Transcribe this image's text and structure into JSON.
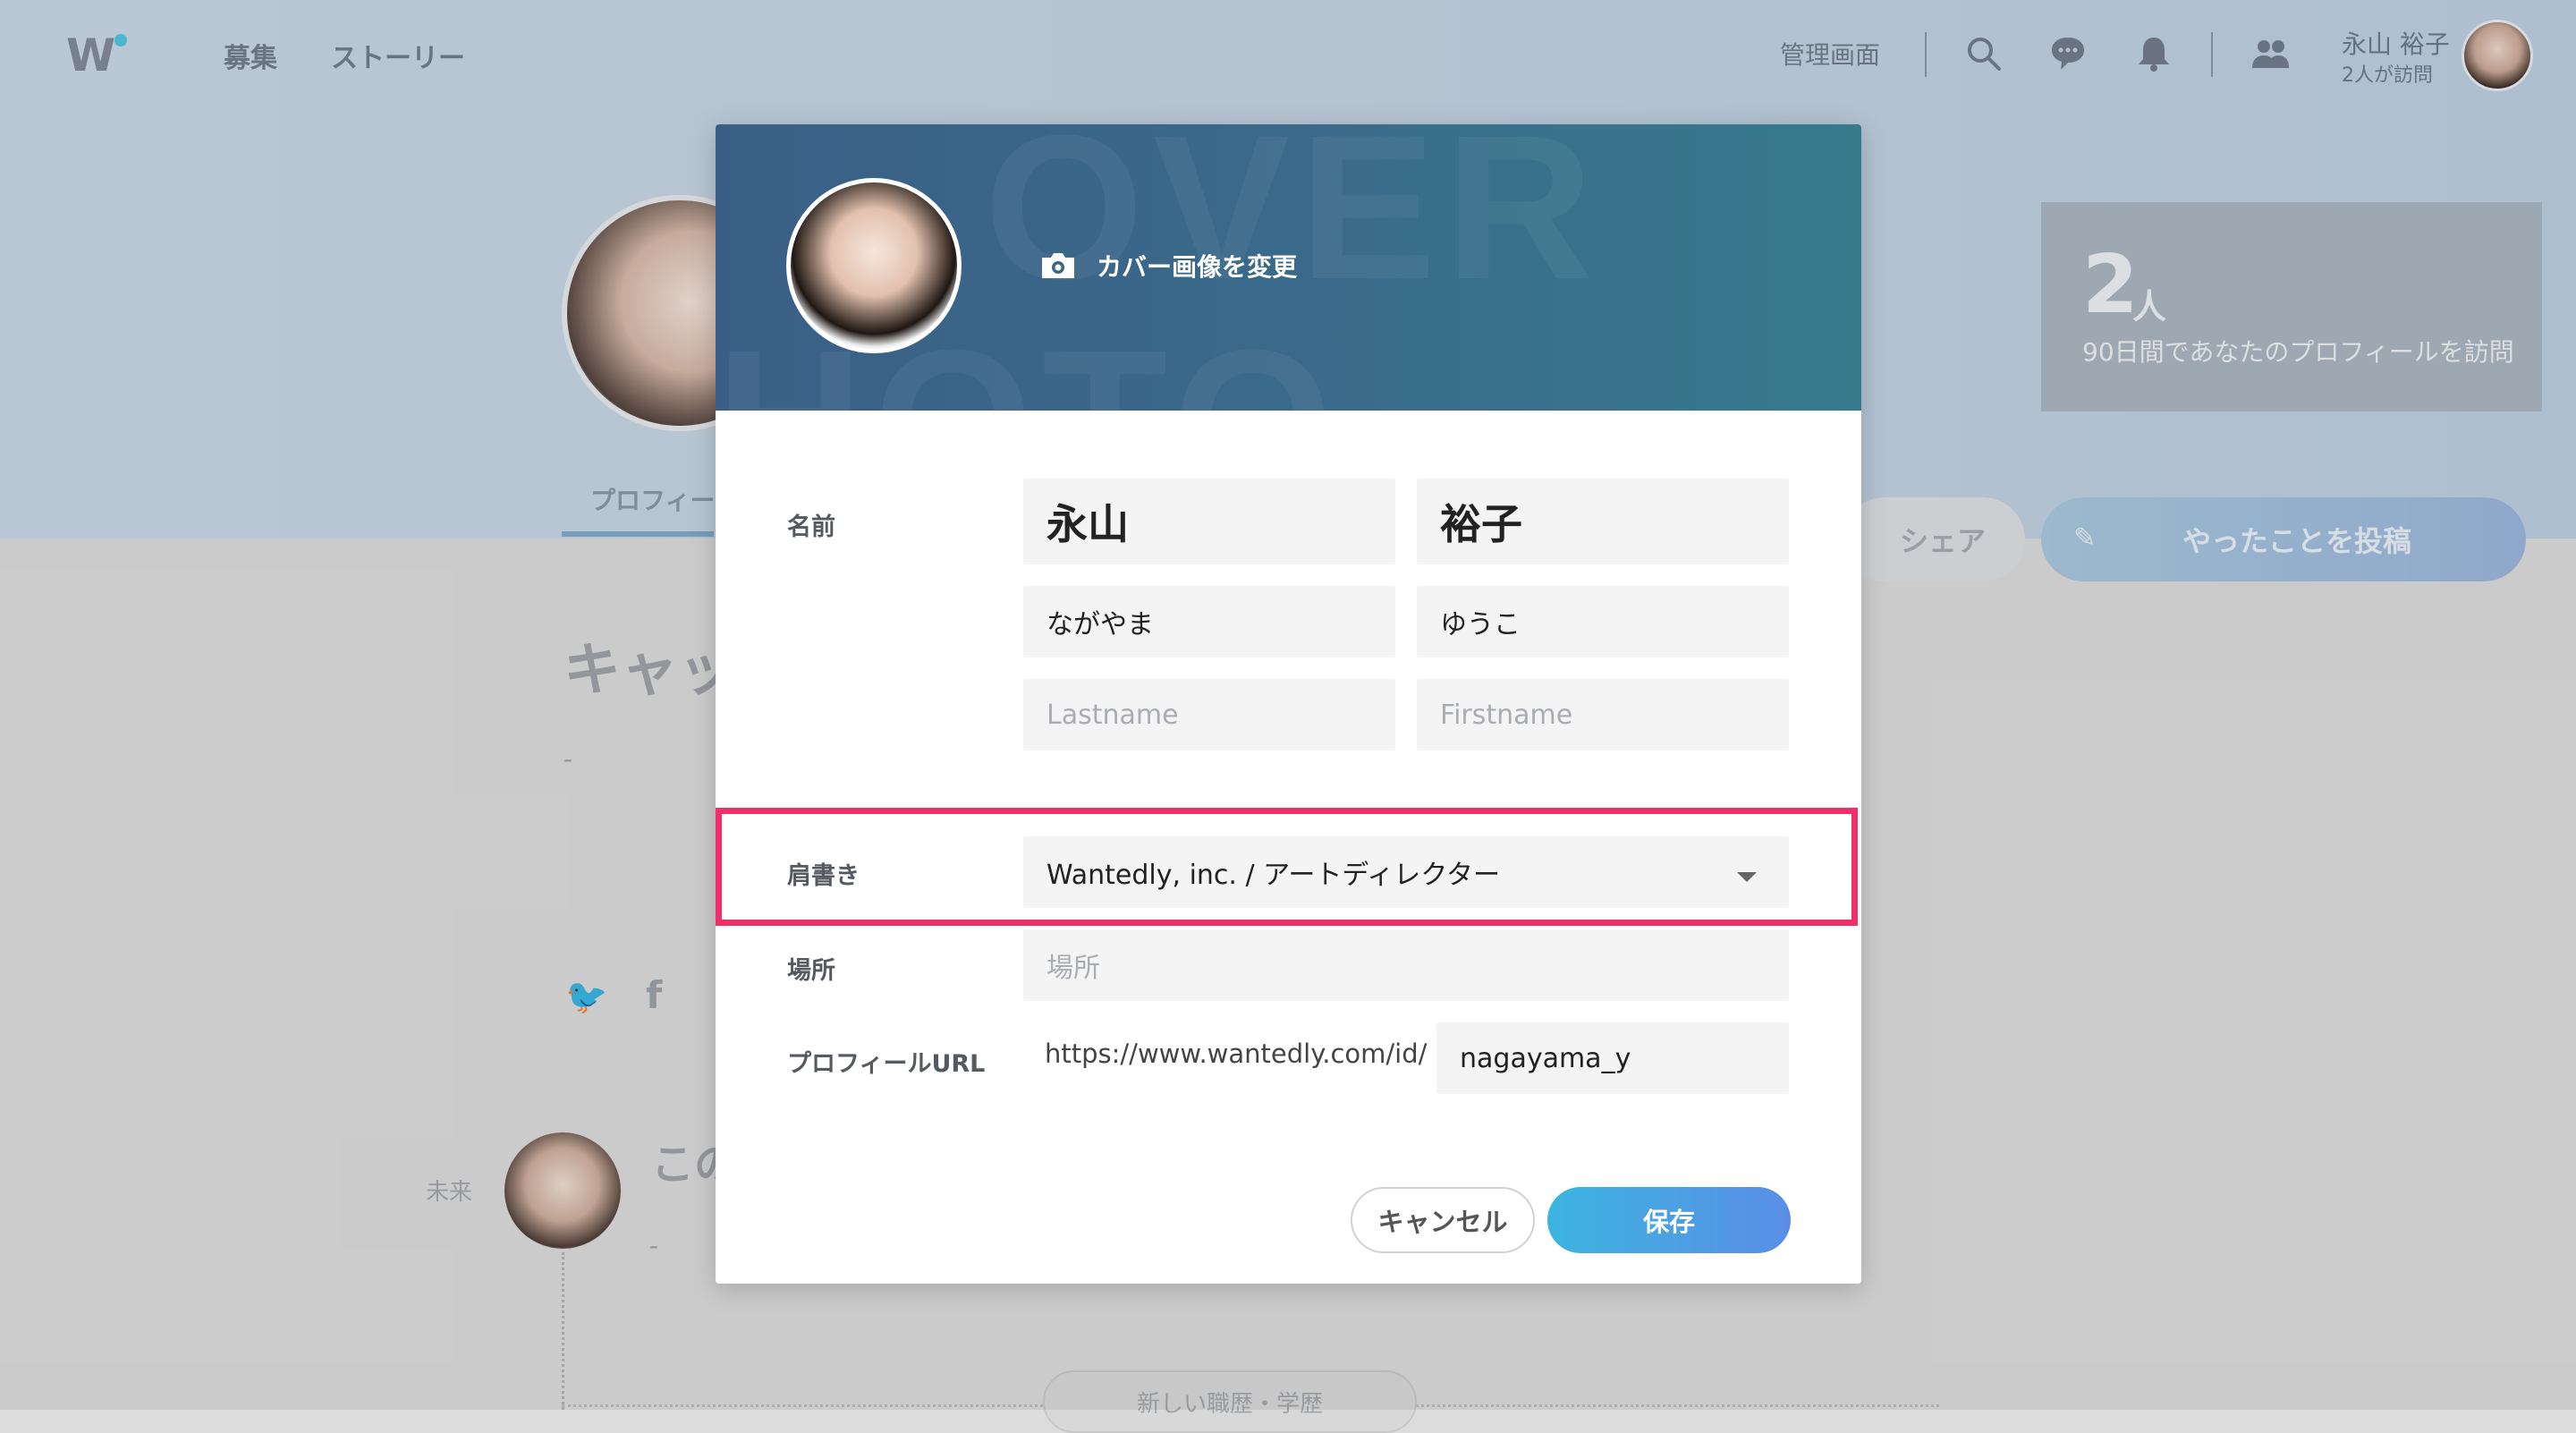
{
  "nav": {
    "logo": "W",
    "links": [
      "募集",
      "ストーリー"
    ],
    "admin_label": "管理画面",
    "user_name": "永山 裕子",
    "user_visits": "2人が訪問"
  },
  "background": {
    "tab_label": "プロフィー",
    "stat_number": "2",
    "stat_unit": "人",
    "stat_label": "90日間であなたのプロフィールを訪問",
    "share_label": "シェア",
    "post_label": "やったことを投稿",
    "career_title": "キャッ",
    "dash": "-",
    "future_label": "未来",
    "future_title": "この",
    "new_history_label": "新しい職歴・学歴"
  },
  "modal": {
    "cover_change_label": "カバー画像を変更",
    "name_label": "名前",
    "last_name": "永山",
    "first_name": "裕子",
    "last_name_kana": "ながやま",
    "first_name_kana": "ゆうこ",
    "last_name_en_placeholder": "Lastname",
    "first_name_en_placeholder": "Firstname",
    "title_label": "肩書き",
    "title_value": "Wantedly, inc. / アートディレクター",
    "location_label": "場所",
    "location_placeholder": "場所",
    "url_label": "プロフィールURL",
    "url_prefix": "https://www.wantedly.com/id/",
    "url_value": "nagayama_y",
    "cancel_label": "キャンセル",
    "save_label": "保存"
  },
  "colors": {
    "highlight": "#ee2f6a",
    "save_gradient_start": "#3cb4e0",
    "save_gradient_end": "#5a8ee6"
  }
}
